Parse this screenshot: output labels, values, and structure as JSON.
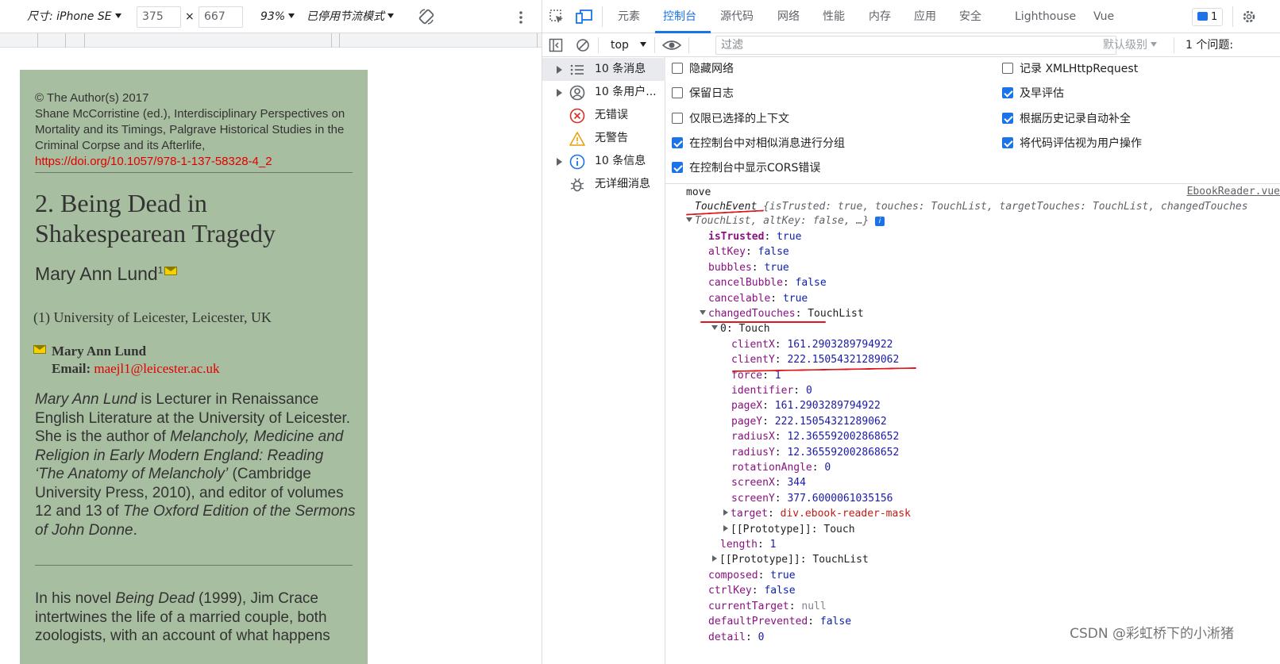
{
  "device_toolbar": {
    "size_label": "尺寸: iPhone SE",
    "width": "375",
    "height": "667",
    "times": "×",
    "zoom": "93%",
    "throttle": "已停用节流模式"
  },
  "ebook": {
    "copyright": "© The Author(s) 2017",
    "citation": "Shane McCorristine (ed.), Interdisciplinary Perspectives on Mortality and its Timings, Palgrave Historical Studies in the Criminal Corpse and its Afterlife,",
    "doi": "https://doi.org/10.1057/978-1-137-58328-4_2",
    "chapter_title": "2. Being Dead in Shakespearean Tragedy",
    "author": "Mary Ann Lund",
    "author_sup": "1",
    "affiliation": "(1)   University of Leicester, Leicester, UK",
    "contact_name": "Mary Ann Lund",
    "email_label": "Email:",
    "email": "maejl1@leicester.ac.uk",
    "bio_name": "Mary Ann Lund",
    "bio_1": " is Lecturer in Renaissance English Literature at the University of Leicester. She is the author of ",
    "bio_book": "Melancholy, Medicine and Religion in Early Modern England: Reading ‘The Anatomy of Melancholy’",
    "bio_2": " (Cambridge University Press, 2010), and editor of volumes 12 and 13 of ",
    "bio_edition": "The Oxford Edition of the Sermons of John Donne",
    "bio_end": ".",
    "body_1": "In his novel ",
    "body_book": "Being Dead",
    "body_2": " (1999), Jim Crace intertwines the life of a married couple, both zoologists, with an account of what happens"
  },
  "devtools": {
    "tabs": [
      "元素",
      "控制台",
      "源代码",
      "网络",
      "性能",
      "内存",
      "应用",
      "安全",
      "Lighthouse",
      "Vue"
    ],
    "active_tab": "控制台",
    "issues_count": "1",
    "context": "top",
    "filter_placeholder": "过滤",
    "level": "默认级别",
    "issues_label": "1 个问题:",
    "sidebar": [
      {
        "label": "10 条消息",
        "icon": "list-icon"
      },
      {
        "label": "10 条用户...",
        "icon": "user-icon"
      },
      {
        "label": "无错误",
        "icon": "error-icon"
      },
      {
        "label": "无警告",
        "icon": "warning-icon"
      },
      {
        "label": "10 条信息",
        "icon": "info-icon"
      },
      {
        "label": "无详细消息",
        "icon": "bug-icon"
      }
    ],
    "settings": {
      "hide_network": "隐藏网络",
      "preserve_log": "保留日志",
      "selected_context": "仅限已选择的上下文",
      "group_similar": "在控制台中对相似消息进行分组",
      "show_cors": "在控制台中显示CORS错误",
      "log_xhr": "记录 XMLHttpRequest",
      "eager_eval": "及早评估",
      "autocomplete": "根据历史记录自动补全",
      "user_activation": "将代码评估视为用户操作"
    },
    "console": {
      "source": "EbookReader.vue",
      "move": "move",
      "touch_event": "TouchEvent",
      "touch_event_preview": " {isTrusted: true, touches: TouchList, targetTouches: TouchList, changedTouches",
      "touchlist_preview": "TouchList, altKey: false, …}",
      "props": [
        {
          "key": "isTrusted",
          "value": "true"
        },
        {
          "key": "altKey",
          "value": "false"
        },
        {
          "key": "bubbles",
          "value": "true"
        },
        {
          "key": "cancelBubble",
          "value": "false"
        },
        {
          "key": "cancelable",
          "value": "true"
        }
      ],
      "changed_touches_key": "changedTouches",
      "changed_touches_val": "TouchList",
      "touch_index": "0: Touch",
      "touch_props": [
        {
          "key": "clientX",
          "value": "161.2903289794922"
        },
        {
          "key": "clientY",
          "value": "222.15054321289062"
        },
        {
          "key": "force",
          "value": "1"
        },
        {
          "key": "identifier",
          "value": "0"
        },
        {
          "key": "pageX",
          "value": "161.2903289794922"
        },
        {
          "key": "pageY",
          "value": "222.15054321289062"
        },
        {
          "key": "radiusX",
          "value": "12.365592002868652"
        },
        {
          "key": "radiusY",
          "value": "12.365592002868652"
        },
        {
          "key": "rotationAngle",
          "value": "0"
        },
        {
          "key": "screenX",
          "value": "344"
        },
        {
          "key": "screenY",
          "value": "377.6000061035156"
        }
      ],
      "target_key": "target",
      "target_val": "div.ebook-reader-mask",
      "proto_touch": "[[Prototype]]: Touch",
      "length_key": "length",
      "length_val": "1",
      "proto_touchlist": "[[Prototype]]: TouchList",
      "tail_props": [
        {
          "key": "composed",
          "value": "true"
        },
        {
          "key": "ctrlKey",
          "value": "false"
        },
        {
          "key": "currentTarget",
          "value": "null"
        },
        {
          "key": "defaultPrevented",
          "value": "false"
        },
        {
          "key": "detail",
          "value": "0"
        }
      ]
    }
  },
  "watermark": "CSDN @彩虹桥下的小淅猪"
}
